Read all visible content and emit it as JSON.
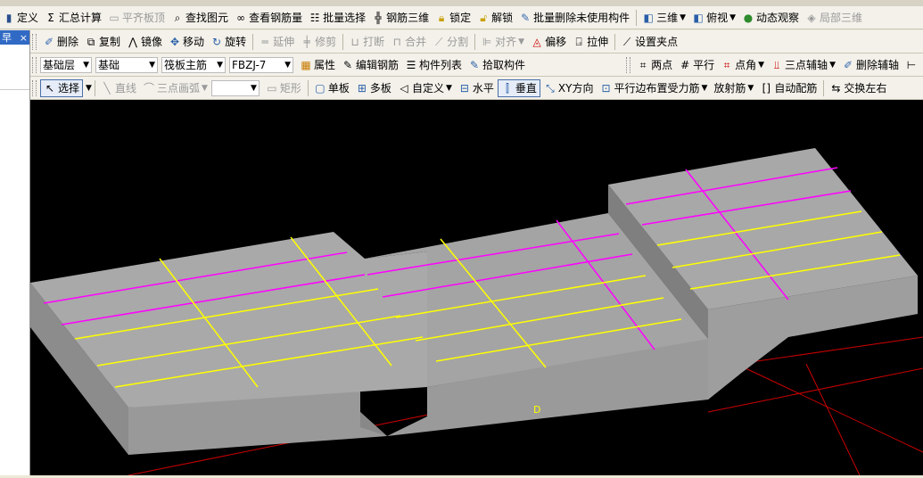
{
  "colors": {
    "slab_top": "#a8a8a8",
    "slab_side": "#8c8c8c",
    "rebar_magenta": "#ff00ff",
    "rebar_yellow": "#ffff00",
    "axis_red": "#cc0000",
    "viewport_bg": "#000000"
  },
  "left": {
    "tab_label": "早",
    "close_label": "×"
  },
  "toolbar1": {
    "define": "定义",
    "summary_calc": "汇总计算",
    "align_top": "平齐板顶",
    "find_element": "查找图元",
    "view_rebar_qty": "查看钢筋量",
    "batch_select": "批量选择",
    "rebar_3d": "钢筋三维",
    "lock": "锁定",
    "unlock": "解锁",
    "batch_delete_unused": "批量删除未使用构件",
    "view_3d": "三维",
    "top_view": "俯视",
    "dynamic_observe": "动态观察",
    "local_3d": "局部三维"
  },
  "toolbar2": {
    "delete": "删除",
    "copy": "复制",
    "mirror": "镜像",
    "move": "移动",
    "rotate": "旋转",
    "extend": "延伸",
    "trim": "修剪",
    "break": "打断",
    "merge": "合并",
    "split": "分割",
    "align": "对齐",
    "offset": "偏移",
    "stretch": "拉伸",
    "set_clamp_point": "设置夹点"
  },
  "toolbar3": {
    "floor_value": "基础层",
    "category_value": "基础",
    "type_value": "筏板主筋",
    "component_value": "FBZJ-7",
    "properties": "属性",
    "edit_rebar": "编辑钢筋",
    "component_list": "构件列表",
    "pick_component": "拾取构件",
    "two_points": "两点",
    "parallel": "平行",
    "point_angle": "点角",
    "three_point_aux": "三点辅轴",
    "delete_aux": "删除辅轴"
  },
  "toolbar4": {
    "select": "选择",
    "line": "直线",
    "three_point_arc": "三点画弧",
    "rect": "矩形",
    "single_slab": "单板",
    "multi_slab": "多板",
    "custom": "自定义",
    "horizontal": "水平",
    "vertical": "垂直",
    "xy_direction": "XY方向",
    "parallel_edge_rebar": "平行边布置受力筋",
    "radial_rebar": "放射筋",
    "auto_rebar": "自动配筋",
    "swap_lr": "交换左右"
  },
  "viewport": {
    "marker_label": "D"
  }
}
